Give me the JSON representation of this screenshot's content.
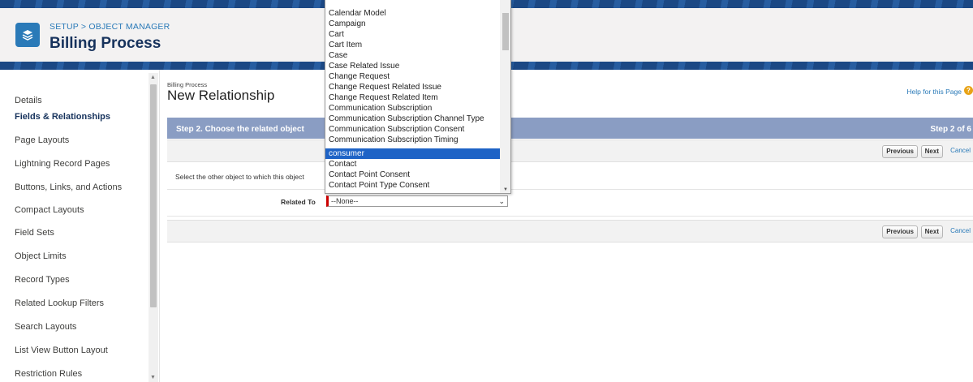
{
  "header": {
    "breadcrumb": "SETUP > OBJECT MANAGER",
    "object_title": "Billing Process"
  },
  "sidebar": {
    "items": [
      {
        "label": "Details"
      },
      {
        "label": "Fields & Relationships",
        "active": true
      },
      {
        "label": "Page Layouts"
      },
      {
        "label": "Lightning Record Pages"
      },
      {
        "label": "Buttons, Links, and Actions"
      },
      {
        "label": "Compact Layouts"
      },
      {
        "label": "Field Sets"
      },
      {
        "label": "Object Limits"
      },
      {
        "label": "Record Types"
      },
      {
        "label": "Related Lookup Filters"
      },
      {
        "label": "Search Layouts"
      },
      {
        "label": "List View Button Layout"
      },
      {
        "label": "Restriction Rules"
      }
    ]
  },
  "main": {
    "crumb": "Billing Process",
    "title": "New Relationship",
    "help_link": "Help for this Page",
    "step_label": "Step 2. Choose the related object",
    "step_count": "Step 2 of 6",
    "buttons": {
      "previous": "Previous",
      "next": "Next",
      "cancel": "Cancel"
    },
    "instruction": "Select the other object to which this object",
    "related_to_label": "Related To",
    "related_to_value": "--None--"
  },
  "dropdown": {
    "options": [
      "Calendar Model",
      "Campaign",
      "Cart",
      "Cart Item",
      "Case",
      "Case Related Issue",
      "Change Request",
      "Change Request Related Issue",
      "Change Request Related Item",
      "Communication Subscription",
      "Communication Subscription Channel Type",
      "Communication Subscription Consent",
      "Communication Subscription Timing",
      "consumer",
      "Contact",
      "Contact Point Consent",
      "Contact Point Type Consent"
    ],
    "highlighted": "consumer"
  },
  "colors": {
    "header_blue": "#1f4f8f",
    "step_bar": "#8a9dc3",
    "link": "#2a7ab8",
    "highlight": "#1e63c6"
  }
}
